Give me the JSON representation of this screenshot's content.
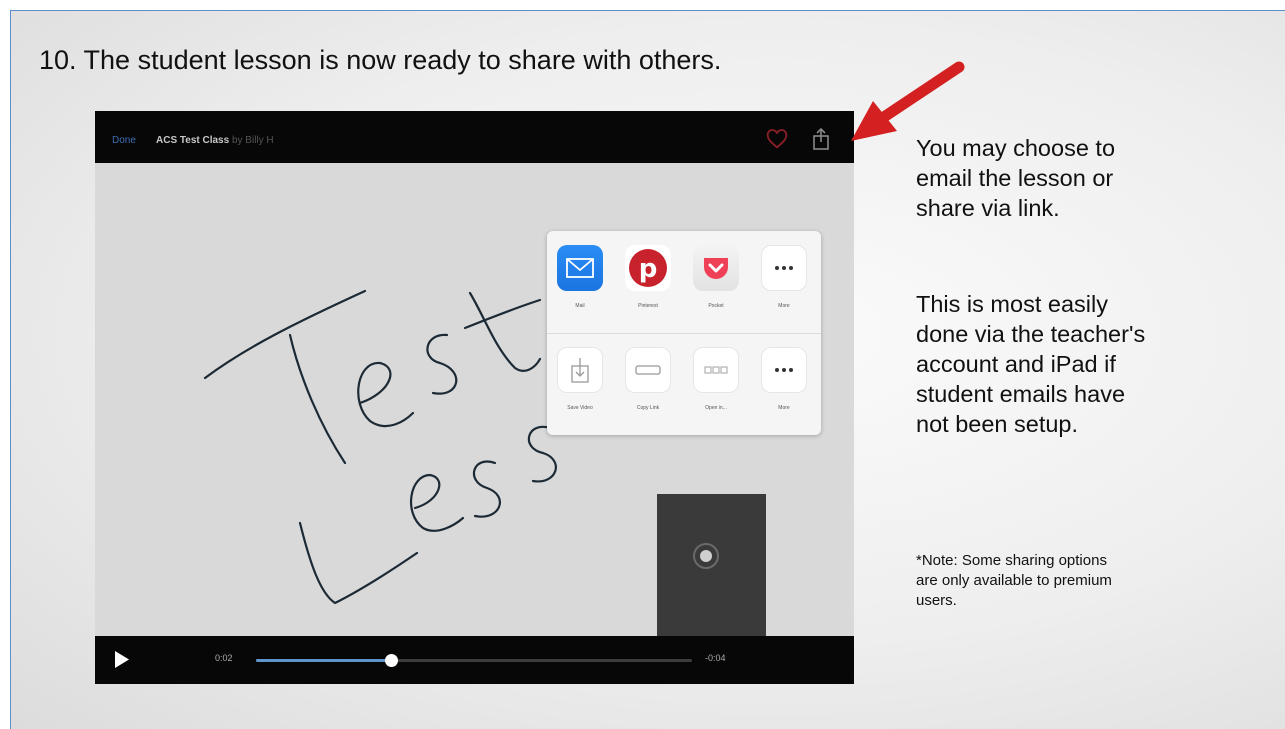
{
  "slide": {
    "title": "10. The student lesson is now ready to share with others.",
    "side_text_lines_1": [
      "You may choose to",
      "email the lesson or",
      "share via link."
    ],
    "side_text_lines_2": [
      "This is most easily",
      "done via the teacher's",
      "account and iPad if",
      "student emails have",
      "not been setup."
    ],
    "note_lines": [
      "*Note: Some sharing options",
      "are only available to premium",
      "users."
    ],
    "arrow_color": "#e02020"
  },
  "player": {
    "done_label": "Done",
    "class_title": "ACS Test Class",
    "by_label": "by Billy H",
    "time_elapsed": "0:02",
    "time_remaining": "-0:04",
    "progress_fraction": 0.31,
    "canvas_text_line1": "Test",
    "canvas_text_line2": "Lesson",
    "accent_color": "#3b6fb3"
  },
  "share_sheet": {
    "row1": [
      {
        "label": "Mail",
        "icon": "mail-icon"
      },
      {
        "label": "Pinterest",
        "icon": "pinterest-icon"
      },
      {
        "label": "Pocket",
        "icon": "pocket-icon"
      },
      {
        "label": "More",
        "icon": "more-icon"
      }
    ],
    "row2": [
      {
        "label": "Save Video",
        "icon": "save-video-icon"
      },
      {
        "label": "Copy Link",
        "icon": "copy-link-icon"
      },
      {
        "label": "Open in...",
        "icon": "open-in-icon"
      },
      {
        "label": "More",
        "icon": "more-icon"
      }
    ]
  }
}
